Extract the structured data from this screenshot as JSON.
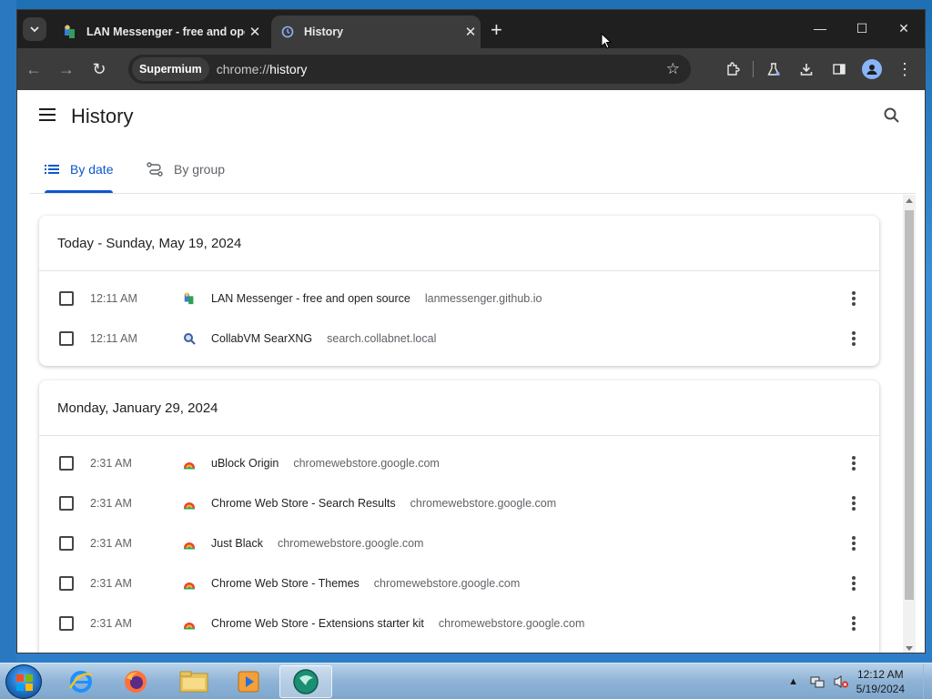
{
  "browser": {
    "tabs": [
      {
        "title": "LAN Messenger - free and ope",
        "active": false
      },
      {
        "title": "History",
        "active": true
      }
    ],
    "profile_chip": "Supermium",
    "url_scheme": "chrome://",
    "url_host": "history"
  },
  "history": {
    "title": "History",
    "tabs": [
      {
        "label": "By date",
        "selected": true
      },
      {
        "label": "By group",
        "selected": false
      }
    ],
    "groups": [
      {
        "heading": "Today - Sunday, May 19, 2024",
        "items": [
          {
            "time": "12:11 AM",
            "title": "LAN Messenger - free and open source",
            "domain": "lanmessenger.github.io",
            "icon": "lan-messenger-icon"
          },
          {
            "time": "12:11 AM",
            "title": "CollabVM SearXNG",
            "domain": "search.collabnet.local",
            "icon": "searxng-icon"
          }
        ]
      },
      {
        "heading": "Monday, January 29, 2024",
        "items": [
          {
            "time": "2:31 AM",
            "title": "uBlock Origin",
            "domain": "chromewebstore.google.com",
            "icon": "webstore-icon"
          },
          {
            "time": "2:31 AM",
            "title": "Chrome Web Store - Search Results",
            "domain": "chromewebstore.google.com",
            "icon": "webstore-icon"
          },
          {
            "time": "2:31 AM",
            "title": "Just Black",
            "domain": "chromewebstore.google.com",
            "icon": "webstore-icon"
          },
          {
            "time": "2:31 AM",
            "title": "Chrome Web Store - Themes",
            "domain": "chromewebstore.google.com",
            "icon": "webstore-icon"
          },
          {
            "time": "2:31 AM",
            "title": "Chrome Web Store - Extensions starter kit",
            "domain": "chromewebstore.google.com",
            "icon": "webstore-icon"
          }
        ]
      }
    ]
  },
  "taskbar": {
    "time": "12:12 AM",
    "date": "5/19/2024"
  },
  "colors": {
    "accent": "#0b57d0",
    "tabbar": "#1f1f1f",
    "toolbar": "#3c3c3c"
  }
}
